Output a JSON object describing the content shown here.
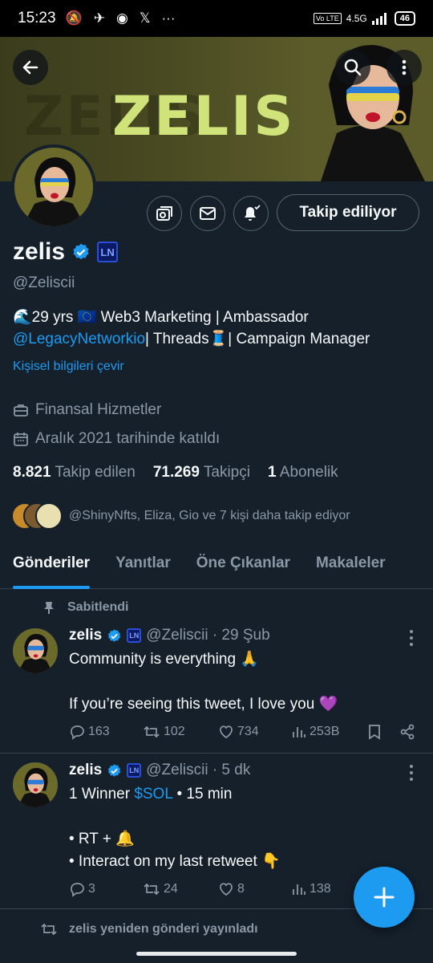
{
  "status_bar": {
    "time": "15:23",
    "network": "4.5G",
    "volte": "Vo LTE",
    "battery": "46"
  },
  "banner": {
    "title": "ZELIS"
  },
  "profile": {
    "follow_label": "Takip ediliyor",
    "name": "zelis",
    "badge": "LN",
    "handle": "@Zeliscii",
    "bio_line1": "🌊29 yrs 🇪🇺 Web3 Marketing | Ambassador",
    "bio_mention": "@LegacyNetworkio",
    "bio_line2_rest": "| Threads🧵| Campaign Manager",
    "translate": "Kişisel bilgileri çevir",
    "category": "Finansal Hizmetler",
    "joined": "Aralık 2021 tarihinde katıldı",
    "following_count": "8.821",
    "following_label": "Takip edilen",
    "followers_count": "71.269",
    "followers_label": "Takipçi",
    "subs_count": "1",
    "subs_label": "Abonelik",
    "known_followers": "@ShinyNfts, Eliza, Gio ve 7 kişi daha takip ediyor"
  },
  "tabs": [
    "Gönderiler",
    "Yanıtlar",
    "Öne Çıkanlar",
    "Makaleler"
  ],
  "pinned_label": "Sabitlendi",
  "tweets": [
    {
      "name": "zelis",
      "badge": "LN",
      "meta": "@Zeliscii · 29 Şub",
      "line1": "Community is everything 🙏",
      "line2": "If you’re seeing this tweet, I love you 💜",
      "replies": "163",
      "retweets": "102",
      "likes": "734",
      "views": "253B"
    },
    {
      "name": "zelis",
      "badge": "LN",
      "meta": "@Zeliscii · 5 dk",
      "line1_a": "1 Winner ",
      "line1_cash": "$SOL",
      "line1_b": " • 15 min",
      "line2": "• RT + 🔔",
      "line3": "• Interact on my last retweet 👇",
      "replies": "3",
      "retweets": "24",
      "likes": "8",
      "views": "138"
    }
  ],
  "retweeted_label": "zelis yeniden gönderi yayınladı",
  "colors": {
    "accent": "#1d9bf0",
    "background": "#15202b",
    "muted": "#8b98a5",
    "banner_text": "#cfe37a"
  }
}
